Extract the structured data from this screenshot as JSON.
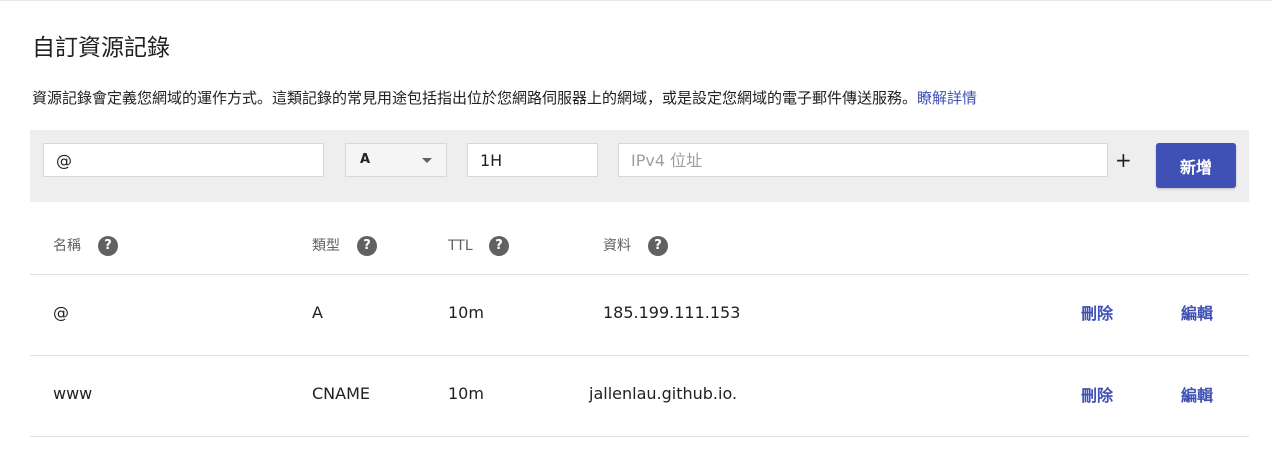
{
  "title": "自訂資源記錄",
  "description": "資源記錄會定義您網域的運作方式。這類記錄的常見用途包括指出位於您網路伺服器上的網域，或是設定您網域的電子郵件傳送服務。",
  "learn_more": "瞭解詳情",
  "add_form": {
    "name_value": "@",
    "type_value": "A",
    "ttl_value": "1H",
    "data_placeholder": "IPv4 位址",
    "plus_label": "+",
    "add_button": "新增"
  },
  "columns": {
    "name": "名稱",
    "type": "類型",
    "ttl": "TTL",
    "data": "資料",
    "help_glyph": "?"
  },
  "records": [
    {
      "name": "@",
      "type": "A",
      "ttl": "10m",
      "data": "185.199.111.153",
      "delete": "刪除",
      "edit": "編輯"
    },
    {
      "name": "www",
      "type": "CNAME",
      "ttl": "10m",
      "data": "jallenlau.github.io.",
      "delete": "刪除",
      "edit": "編輯"
    }
  ],
  "colors": {
    "accent": "#3f51b5",
    "form_bg": "#eeeeee",
    "help_icon": "#616161"
  },
  "icons": {
    "help": "help-circle-icon",
    "dropdown": "caret-down-icon"
  }
}
